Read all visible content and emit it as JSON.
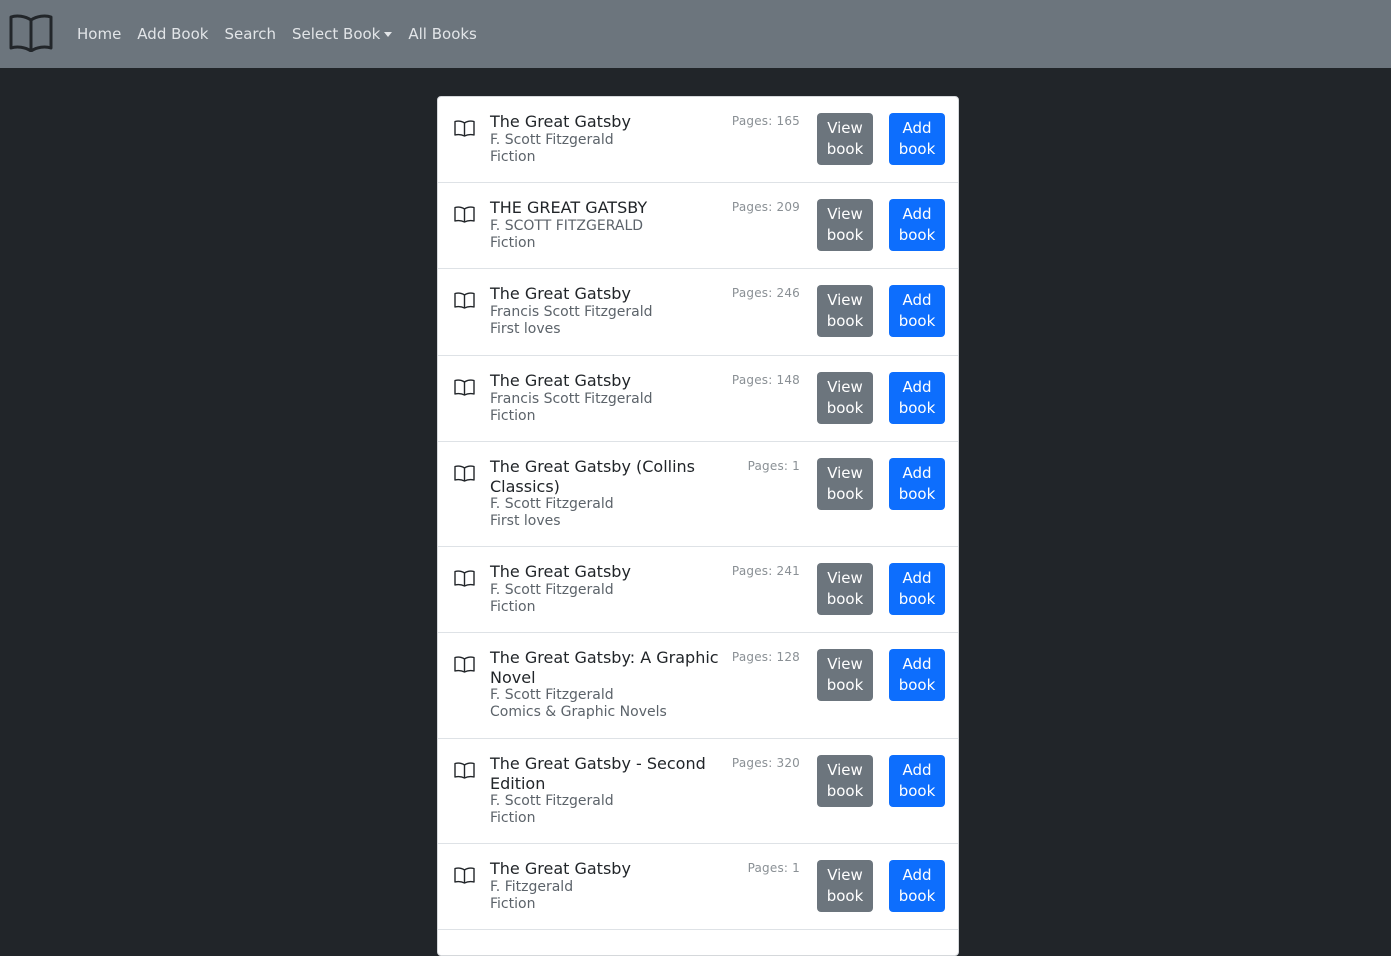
{
  "nav": {
    "brand_icon": "open-book-icon",
    "links": [
      {
        "label": "Home"
      },
      {
        "label": "Add Book"
      },
      {
        "label": "Search"
      },
      {
        "label": "Select Book"
      },
      {
        "label": "All Books"
      }
    ]
  },
  "book_icon": "open-book-icon",
  "button_line2": "book",
  "view_label": "View",
  "add_label": "Add",
  "books": [
    {
      "title": "The Great Gatsby",
      "author": "F. Scott Fitzgerald",
      "genre": "Fiction",
      "pages": "Pages: 165"
    },
    {
      "title": "THE GREAT GATSBY",
      "author": "F. SCOTT FITZGERALD",
      "genre": "Fiction",
      "pages": "Pages: 209"
    },
    {
      "title": "The Great Gatsby",
      "author": "Francis Scott Fitzgerald",
      "genre": "First loves",
      "pages": "Pages: 246"
    },
    {
      "title": "The Great Gatsby",
      "author": "Francis Scott Fitzgerald",
      "genre": "Fiction",
      "pages": "Pages: 148"
    },
    {
      "title": "The Great Gatsby (Collins Classics)",
      "author": "F. Scott Fitzgerald",
      "genre": "First loves",
      "pages": "Pages: 1"
    },
    {
      "title": "The Great Gatsby",
      "author": "F. Scott Fitzgerald",
      "genre": "Fiction",
      "pages": "Pages: 241"
    },
    {
      "title": "The Great Gatsby: A Graphic Novel",
      "author": "F. Scott Fitzgerald",
      "genre": "Comics & Graphic Novels",
      "pages": "Pages: 128"
    },
    {
      "title": "The Great Gatsby - Second Edition",
      "author": "F. Scott Fitzgerald",
      "genre": "Fiction",
      "pages": "Pages: 320"
    },
    {
      "title": "The Great Gatsby",
      "author": "F. Fitzgerald",
      "genre": "Fiction",
      "pages": "Pages: 1"
    }
  ]
}
